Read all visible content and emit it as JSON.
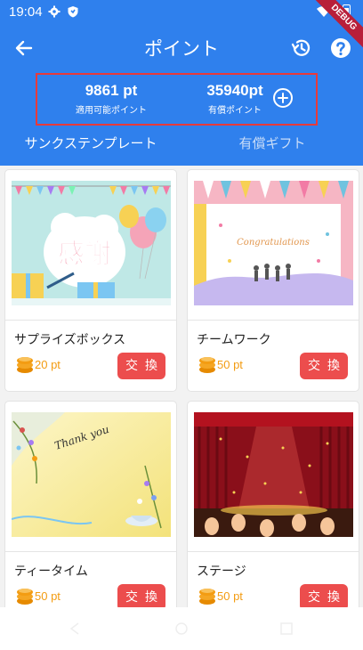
{
  "status_bar": {
    "time": "19:04",
    "debug_label": "DEBUG"
  },
  "app_bar": {
    "title": "ポイント"
  },
  "points": {
    "usable_value": "9861 pt",
    "usable_label": "適用可能ポイント",
    "paid_value": "35940pt",
    "paid_label": "有償ポイント"
  },
  "tabs": [
    {
      "label": "サンクステンプレート",
      "active": true
    },
    {
      "label": "有償ギフト",
      "active": false
    }
  ],
  "cards": [
    {
      "name": "サプライズボックス",
      "price": "20 pt",
      "button": "交換",
      "image_text": "感謝"
    },
    {
      "name": "チームワーク",
      "price": "50 pt",
      "button": "交換",
      "image_text": "Congratulations"
    },
    {
      "name": "ティータイム",
      "price": "50 pt",
      "button": "交換",
      "image_text": "Thank you"
    },
    {
      "name": "ステージ",
      "price": "50 pt",
      "button": "交換",
      "image_text": ""
    }
  ],
  "colors": {
    "primary": "#2f80ed",
    "highlight_border": "#e83a3a",
    "exchange_button": "#ec4d4d",
    "price": "#f39c12"
  }
}
